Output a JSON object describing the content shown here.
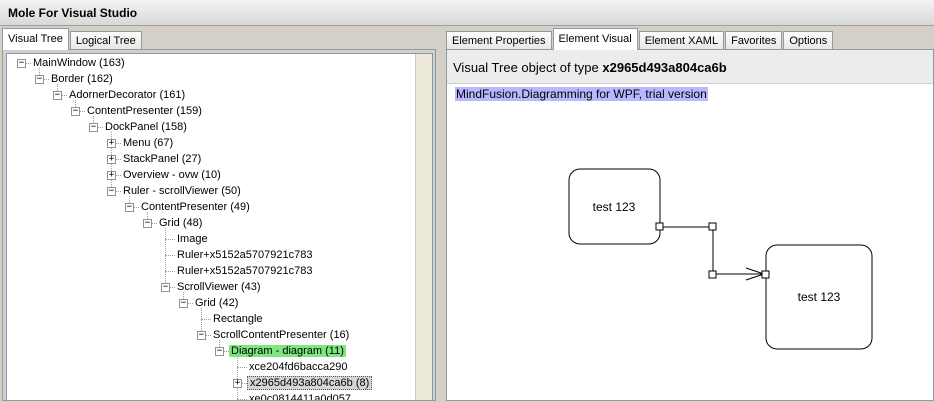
{
  "window": {
    "title": "Mole For Visual Studio"
  },
  "left_tabs": [
    "Visual Tree",
    "Logical Tree"
  ],
  "right_tabs": [
    "Element Properties",
    "Element Visual",
    "Element XAML",
    "Favorites",
    "Options"
  ],
  "tree": [
    {
      "label": "MainWindow (163)",
      "level": 0,
      "expander": "-"
    },
    {
      "label": "Border (162)",
      "level": 1,
      "expander": "-"
    },
    {
      "label": "AdornerDecorator (161)",
      "level": 2,
      "expander": "-"
    },
    {
      "label": "ContentPresenter (159)",
      "level": 3,
      "expander": "-"
    },
    {
      "label": "DockPanel (158)",
      "level": 4,
      "expander": "-"
    },
    {
      "label": "Menu (67)",
      "level": 5,
      "expander": "+"
    },
    {
      "label": "StackPanel (27)",
      "level": 5,
      "expander": "+"
    },
    {
      "label": "Overview - ovw (10)",
      "level": 5,
      "expander": "+"
    },
    {
      "label": "Ruler - scrollViewer (50)",
      "level": 5,
      "expander": "-"
    },
    {
      "label": "ContentPresenter (49)",
      "level": 6,
      "expander": "-"
    },
    {
      "label": "Grid (48)",
      "level": 7,
      "expander": "-"
    },
    {
      "label": "Image",
      "level": 8,
      "expander": ""
    },
    {
      "label": "Ruler+x5152a5707921c783",
      "level": 8,
      "expander": ""
    },
    {
      "label": "Ruler+x5152a5707921c783",
      "level": 8,
      "expander": ""
    },
    {
      "label": "ScrollViewer (43)",
      "level": 8,
      "expander": "-"
    },
    {
      "label": "Grid (42)",
      "level": 9,
      "expander": "-"
    },
    {
      "label": "Rectangle",
      "level": 10,
      "expander": ""
    },
    {
      "label": "ScrollContentPresenter (16)",
      "level": 10,
      "expander": "-"
    },
    {
      "label": "Diagram - diagram (11)",
      "level": 11,
      "expander": "-",
      "highlight": "green"
    },
    {
      "label": "xce204fd6bacca290",
      "level": 12,
      "expander": ""
    },
    {
      "label": "x2965d493a804ca6b (8)",
      "level": 12,
      "expander": "+",
      "highlight": "selected"
    },
    {
      "label": "xe0c0814411a0d057",
      "level": 12,
      "expander": ""
    }
  ],
  "element_visual": {
    "caption_prefix": "Visual Tree object of type",
    "caption_type": "x2965d493a804ca6b",
    "trial_text": "MindFusion.Diagramming for WPF, trial version",
    "node1_text": "test 123",
    "node2_text": "test 123"
  }
}
